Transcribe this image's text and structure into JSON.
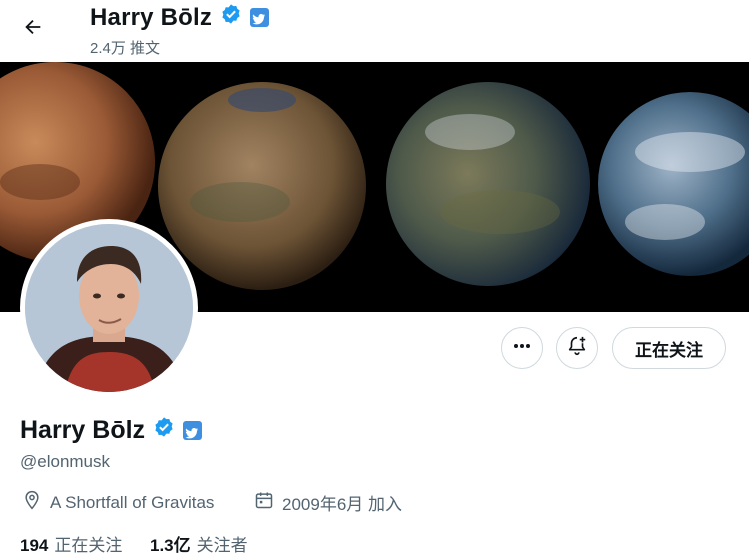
{
  "header": {
    "back_icon": "arrow-left-icon",
    "name": "Harry Bōlz",
    "tweet_count": "2.4万 推文"
  },
  "profile": {
    "name": "Harry Bōlz",
    "handle": "@elonmusk",
    "location": "A Shortfall of Gravitas",
    "joined": "2009年6月 加入",
    "following_count": "194",
    "following_label": "正在关注",
    "followers_count": "1.3亿",
    "followers_label": "关注者"
  },
  "actions": {
    "more_icon": "more-horizontal-icon",
    "notify_icon": "bell-plus-icon",
    "follow_label": "正在关注"
  },
  "colors": {
    "verified_blue": "#1d9bf0",
    "affiliate_blue": "#3f8fe0",
    "text": "#0f1419",
    "secondary": "#536471"
  }
}
